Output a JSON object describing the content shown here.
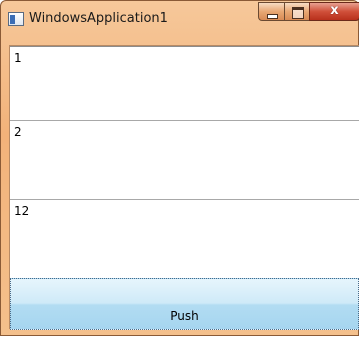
{
  "window": {
    "title": "WindowsApplication1",
    "close_glyph": "x"
  },
  "rows": [
    {
      "text": "1"
    },
    {
      "text": "2"
    },
    {
      "text": "12"
    }
  ],
  "push_button": {
    "label": "Push"
  },
  "colors": {
    "frame": "#f2b27a",
    "close_button": "#c8402a",
    "button_top": "#e6f5fc",
    "button_bottom": "#a6d6f0"
  },
  "icons": [
    "app-icon",
    "minimize-icon",
    "maximize-icon",
    "close-icon"
  ]
}
